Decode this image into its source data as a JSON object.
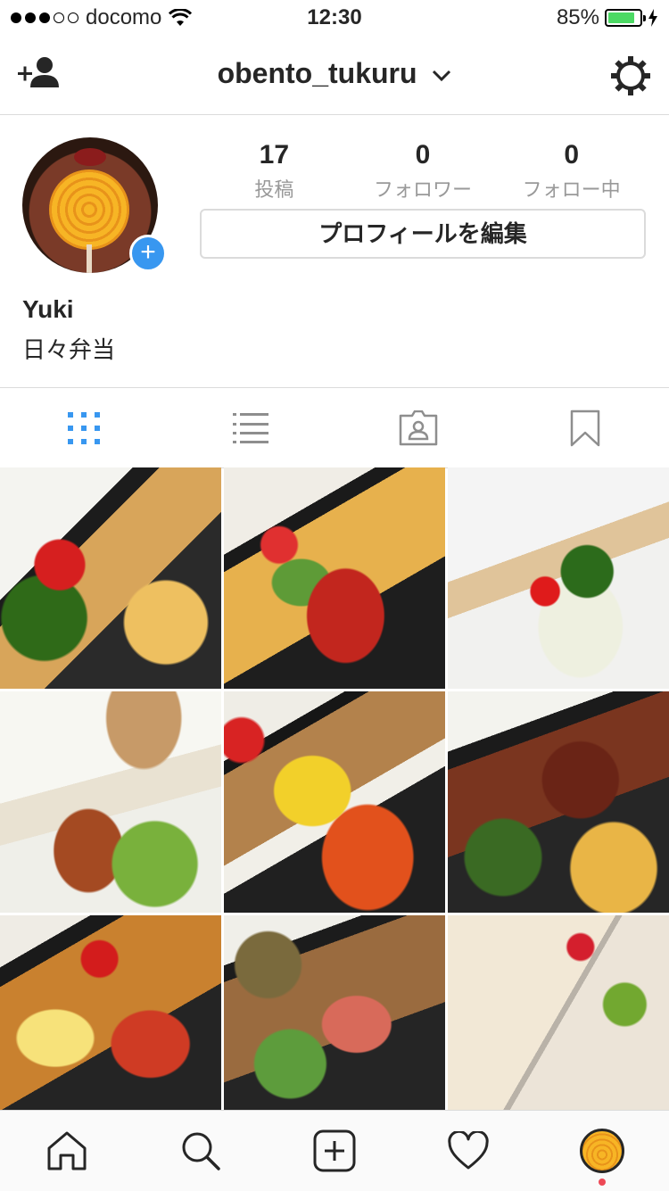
{
  "status_bar": {
    "carrier": "docomo",
    "time": "12:30",
    "battery": "85%",
    "signal_icon": "signal-dots-icon",
    "wifi_icon": "wifi-icon",
    "charging_icon": "charging-bolt-icon"
  },
  "header": {
    "username": "obento_tukuru",
    "left_icon": "add-user-icon",
    "right_icon": "gear-icon"
  },
  "profile": {
    "posts_count": "17",
    "posts_label": "投稿",
    "followers_count": "0",
    "followers_label": "フォロワー",
    "following_count": "0",
    "following_label": "フォロー中",
    "edit_button": "プロフィールを編集",
    "name": "Yuki",
    "bio": "日々弁当"
  },
  "view_tabs": [
    {
      "name": "grid-view",
      "icon": "grid-icon",
      "active": true
    },
    {
      "name": "list-view",
      "icon": "list-icon",
      "active": false
    },
    {
      "name": "tagged",
      "icon": "tagged-person-icon",
      "active": false
    },
    {
      "name": "saved",
      "icon": "bookmark-icon",
      "active": false
    }
  ],
  "posts": [
    {
      "alt": "bento-1"
    },
    {
      "alt": "bento-2"
    },
    {
      "alt": "bento-3"
    },
    {
      "alt": "bento-4"
    },
    {
      "alt": "bento-5"
    },
    {
      "alt": "bento-6"
    },
    {
      "alt": "bento-7"
    },
    {
      "alt": "bento-8"
    },
    {
      "alt": "bento-9"
    }
  ],
  "bottom_nav": [
    {
      "icon": "home-icon"
    },
    {
      "icon": "search-icon"
    },
    {
      "icon": "new-post-icon"
    },
    {
      "icon": "heart-icon"
    },
    {
      "icon": "profile-avatar-icon",
      "active": true
    }
  ],
  "colors": {
    "accent": "#3897f0",
    "battery": "#4cd964",
    "notification": "#ed4956",
    "text": "#262626",
    "muted": "#999999",
    "border": "#dbdbdb"
  }
}
